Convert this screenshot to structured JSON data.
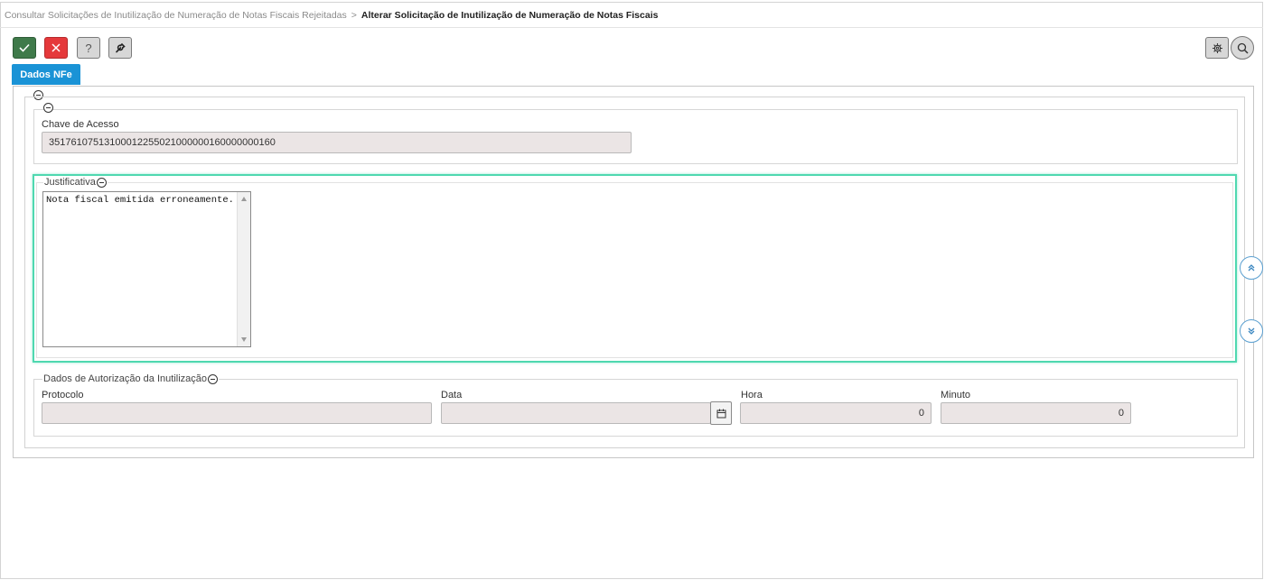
{
  "breadcrumb": {
    "parent": "Consultar Solicitações de Inutilização de Numeração de Notas Fiscais Rejeitadas",
    "separator": ">",
    "current": "Alterar Solicitação de Inutilização de Numeração de Notas Fiscais"
  },
  "toolbar": {
    "confirm_icon": "check-icon",
    "cancel_icon": "close-icon",
    "help_label": "?",
    "tools_icon": "wrench-icon",
    "settings_icon": "gear-icon",
    "search_icon": "search-icon"
  },
  "tabs": [
    {
      "label": "Dados NFe",
      "active": true
    }
  ],
  "form": {
    "chave_acesso": {
      "label": "Chave de Acesso",
      "value": "35176107513100012255021000000160000000160"
    },
    "justificativa": {
      "legend": "Justificativa",
      "value": "Nota fiscal emitida erroneamente."
    },
    "autorizacao": {
      "legend": "Dados de Autorização da Inutilização",
      "protocolo": {
        "label": "Protocolo",
        "value": ""
      },
      "data": {
        "label": "Data",
        "value": "",
        "icon": "calendar-icon"
      },
      "hora": {
        "label": "Hora",
        "value": "0"
      },
      "minuto": {
        "label": "Minuto",
        "value": "0"
      }
    }
  },
  "colors": {
    "tab_active": "#1a93d6",
    "confirm": "#3f7a4a",
    "cancel": "#e5393b",
    "highlight": "#4fd8b0",
    "input_readonly": "#ebe5e5"
  }
}
